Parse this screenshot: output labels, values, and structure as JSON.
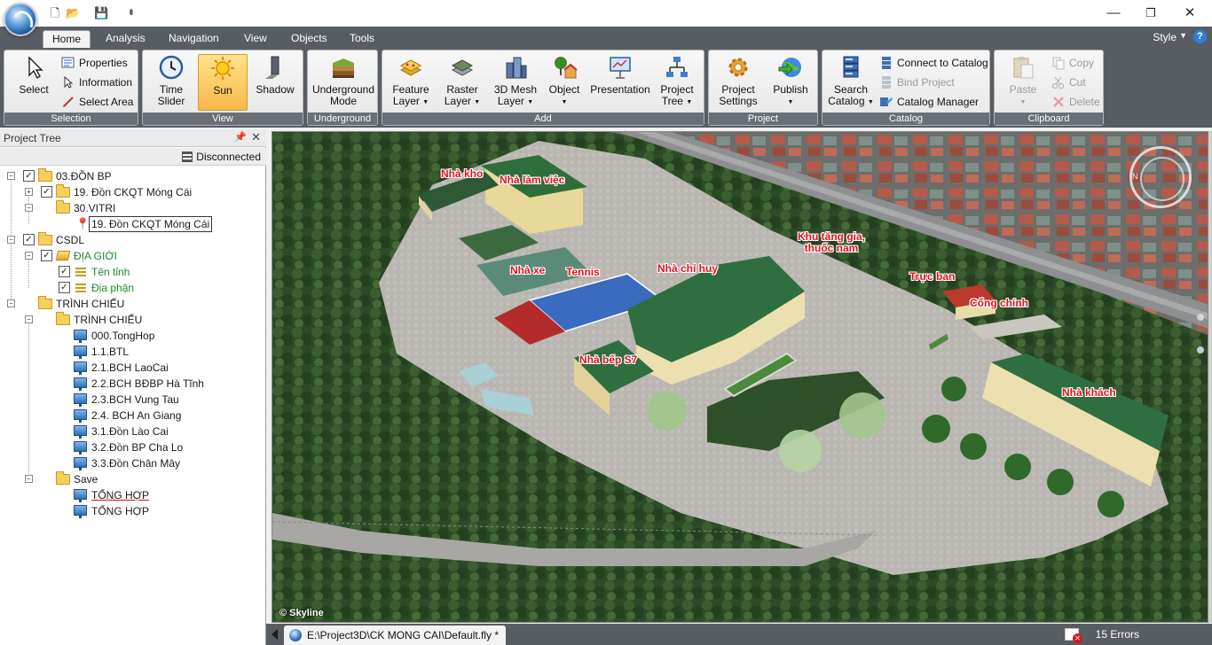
{
  "title_bar": {
    "window_controls": [
      "—",
      "❐",
      "✕"
    ]
  },
  "quick_access": {
    "icons": [
      "new-file-icon",
      "open-folder-icon",
      "save-icon",
      "customize-icon"
    ],
    "customize_glyph": "⇟"
  },
  "tabs": [
    {
      "label": "Home",
      "active": true
    },
    {
      "label": "Analysis"
    },
    {
      "label": "Navigation"
    },
    {
      "label": "View"
    },
    {
      "label": "Objects"
    },
    {
      "label": "Tools"
    }
  ],
  "style_menu": {
    "label": "Style",
    "help": "?"
  },
  "ribbon": {
    "selection": {
      "label": "Selection",
      "select": "Select",
      "properties": "Properties",
      "information": "Information",
      "select_area": "Select Area"
    },
    "view": {
      "label": "View",
      "time_slider_1": "Time",
      "time_slider_2": "Slider",
      "sun": "Sun",
      "shadow": "Shadow"
    },
    "underground": {
      "label": "Underground",
      "mode_1": "Underground",
      "mode_2": "Mode"
    },
    "add": {
      "label": "Add",
      "feature_1": "Feature",
      "feature_2": "Layer",
      "raster_1": "Raster",
      "raster_2": "Layer",
      "mesh_1": "3D Mesh",
      "mesh_2": "Layer",
      "object": "Object",
      "presentation": "Presentation",
      "tree_1": "Project",
      "tree_2": "Tree"
    },
    "project": {
      "label": "Project",
      "settings_1": "Project",
      "settings_2": "Settings",
      "publish": "Publish"
    },
    "catalog": {
      "label": "Catalog",
      "search_1": "Search",
      "search_2": "Catalog",
      "connect": "Connect to Catalog",
      "bind": "Bind Project",
      "manager": "Catalog Manager"
    },
    "clipboard": {
      "label": "Clipboard",
      "paste": "Paste",
      "copy": "Copy",
      "cut": "Cut",
      "delete": "Delete"
    }
  },
  "project_tree": {
    "title": "Project Tree",
    "status": "Disconnected",
    "items": [
      "03.ĐỒN BP",
      "19. Đồn CKQT Móng Cái",
      "30.VITRI",
      "19. Đồn CKQT Móng Cái",
      "CSDL",
      "ĐỊA GIỚI",
      "Tên tỉnh",
      "Địa phận",
      "TRÌNH CHIẾU",
      "TRÌNH CHIẾU",
      "000.TongHop",
      "1.1.BTL",
      "2.1.BCH LaoCai",
      "2.2.BCH BĐBP Hà Tĩnh",
      "2.3.BCH Vung Tau",
      "2.4. BCH An Giang",
      "3.1.Đồn Lào Cai",
      "3.2.Đồn BP Cha Lo",
      "3.3.Đồn Chân Mây",
      "Save",
      "TỔNG HỢP",
      "TỔNG HỢP"
    ]
  },
  "map_labels": {
    "nha_kho": "Nhà kho",
    "nha_lam_viec": "Nhà làm việc",
    "khu_tang_gia_1": "Khu tăng gia,",
    "khu_tang_gia_2": "thuốc nam",
    "nha_xe": "Nhà xe",
    "tennis": "Tennis",
    "nha_chi_huy": "Nhà chỉ huy",
    "truc_ban": "Trực ban",
    "cong_chinh": "Cổng chính",
    "nha_bep": "Nhà bếp S7",
    "nha_khach": "Nhà khách"
  },
  "copyright": "© Skyline",
  "status_bar": {
    "document": "E:\\Project3D\\CK MONG CAI\\Default.fly *",
    "errors": "15 Errors"
  }
}
